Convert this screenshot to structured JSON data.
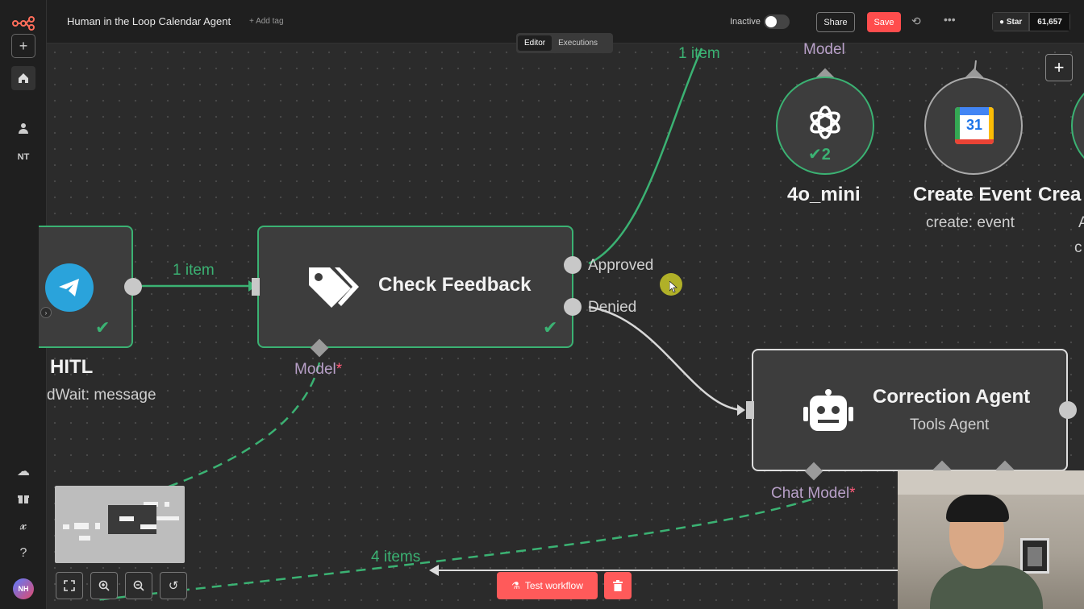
{
  "app": {
    "workflow_title": "Human in the Loop Calendar Agent",
    "add_tag": "+ Add tag",
    "status_label": "Inactive",
    "share_label": "Share",
    "save_label": "Save",
    "github_star_label": "Star",
    "github_star_count": "61,657",
    "user_initials_sidebar": "NT",
    "avatar_initials": "NH"
  },
  "tabs": [
    {
      "label": "Editor",
      "active": true
    },
    {
      "label": "Executions",
      "active": false
    }
  ],
  "nodes": {
    "hitl": {
      "title": "HITL",
      "subtitle": "dWait: message",
      "icon": "telegram-icon"
    },
    "check_feedback": {
      "title": "Check Feedback",
      "icon": "tags-icon",
      "outputs": [
        "Approved",
        "Denied"
      ],
      "sub_input": "Model",
      "sub_input_required": "*"
    },
    "correction_agent": {
      "title": "Correction Agent",
      "subtitle": "Tools Agent",
      "icon": "robot-icon",
      "sub_input": "Chat Model",
      "sub_input_required": "*"
    },
    "model_4o": {
      "title": "4o_mini",
      "top_label": "Model",
      "icon": "openai-icon",
      "run_count": "2"
    },
    "create_event": {
      "title": "Create Event",
      "subtitle": "create: event",
      "icon": "google-calendar-icon",
      "calendar_day": "31"
    },
    "partial_node": {
      "title": "Crea",
      "subtitle_a": "A",
      "subtitle_b": "c"
    }
  },
  "connections": {
    "hitl_to_check": "1 item",
    "approved_up": "1 item",
    "bottom_items": "4 items"
  },
  "controls": {
    "test_workflow_label": "Test workflow"
  },
  "colors": {
    "success": "#3bb273",
    "accent": "#ff5a5a",
    "node_bg": "#3d3d3d",
    "canvas_bg": "#2b2b2b"
  }
}
